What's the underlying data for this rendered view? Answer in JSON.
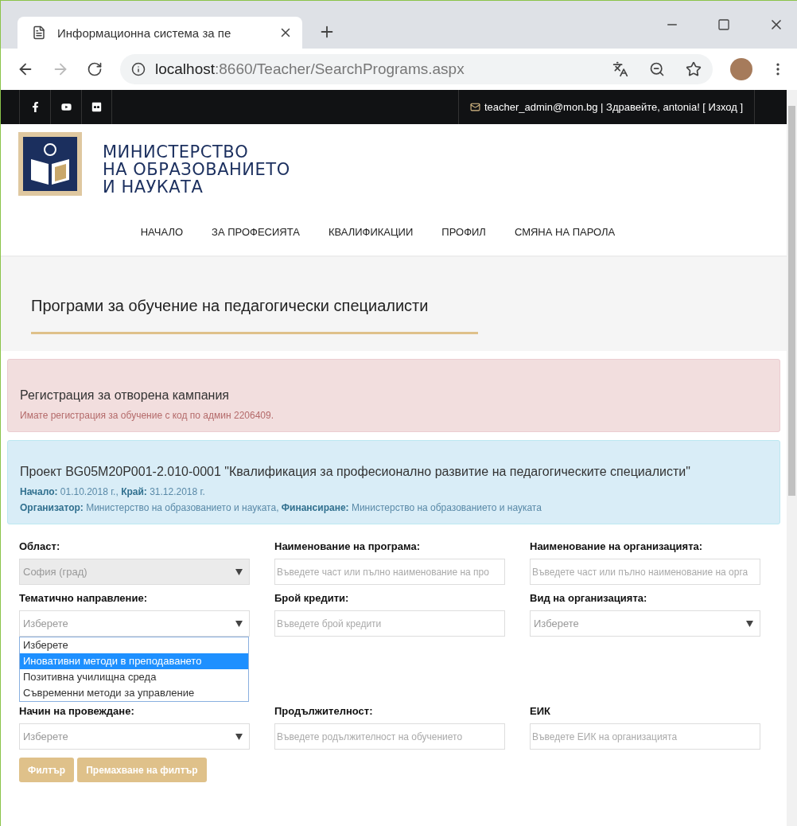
{
  "browser": {
    "tab_title": "Информационна система за пе",
    "url_host": "localhost",
    "url_path": ":8660/Teacher/SearchPrograms.aspx"
  },
  "topbar": {
    "user_text": "teacher_admin@mon.bg | Здравейте, antonia! [ Изход ]"
  },
  "logo": {
    "lines": [
      "МИНИСТЕРСТВО",
      "НА ОБРАЗОВАНИЕТО",
      "И НАУКАТА"
    ]
  },
  "nav": [
    {
      "label": "НАЧАЛО"
    },
    {
      "label": "ЗА ПРОФЕСИЯТА"
    },
    {
      "label": "КВАЛИФИКАЦИИ"
    },
    {
      "label": "ПРОФИЛ"
    },
    {
      "label": "СМЯНА НА ПАРОЛА"
    }
  ],
  "page_title": "Програми за обучение на педагогически специалисти",
  "alerts": [
    {
      "kind": "danger",
      "title": "Регистрация за отворена кампания",
      "lines": [
        "Имате регистрация за обучение с код по админ 2206409."
      ]
    },
    {
      "kind": "info",
      "title": "Проект BG05M20P001-2.010-0001 \"Квалификация за професионално развитие на педагогическите специалисти\"",
      "lines": [
        "**Начало:** 01.10.2018 г., **Край:** 31.12.2018 г.",
        "**Организатор:** Министерство на образованието и науката, **Финансиране:** Министерство на образованието и науката"
      ]
    }
  ],
  "filters": [
    {
      "label": "Област:",
      "kind": "select",
      "value": "София (град)",
      "disabled": true
    },
    {
      "label": "Наименование на програма:",
      "kind": "input",
      "placeholder": "Въведете част или пълно наименование на про"
    },
    {
      "label": "Наименование на организацията:",
      "kind": "input",
      "placeholder": "Въведете част или пълно наименование на орга"
    },
    {
      "label": "Тематично направление:",
      "kind": "select",
      "value": "Изберете",
      "disabled": false,
      "open": true,
      "options": [
        {
          "label": "Изберете",
          "highlighted": false
        },
        {
          "label": "Иновативни методи в преподаването",
          "highlighted": true
        },
        {
          "label": "Позитивна училищна среда",
          "highlighted": false
        },
        {
          "label": "Съвременни методи за управление",
          "highlighted": false
        }
      ]
    },
    {
      "label": "Брой кредити:",
      "kind": "input",
      "placeholder": "Въведете брой кредити"
    },
    {
      "label": "Вид на организацията:",
      "kind": "select",
      "value": "Изберете",
      "disabled": false
    },
    {
      "label": "Начин на провеждане:",
      "kind": "select",
      "value": "Изберете",
      "disabled": false
    },
    {
      "label": "Продължителност:",
      "kind": "input",
      "placeholder": "Въведете родължителност на обучението"
    },
    {
      "label": "ЕИК",
      "kind": "input",
      "placeholder": "Въведете ЕИК на организацията"
    }
  ],
  "buttons": [
    "Филтър",
    "Премахване на филтър"
  ]
}
